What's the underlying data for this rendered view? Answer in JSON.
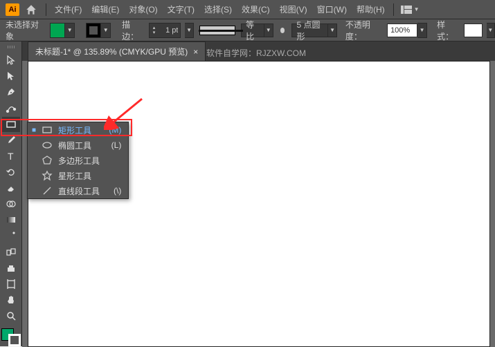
{
  "menubar": {
    "logo": "Ai",
    "items": [
      "文件(F)",
      "编辑(E)",
      "对象(O)",
      "文字(T)",
      "选择(S)",
      "效果(C)",
      "视图(V)",
      "窗口(W)",
      "帮助(H)"
    ]
  },
  "controlbar": {
    "no_selection": "未选择对象",
    "fill_color": "#00a651",
    "stroke_color": "#000000",
    "stroke_label": "描边：",
    "stroke_value": "1 pt",
    "scale_label": "等比",
    "brush_label": "5 点圆形",
    "opacity_label": "不透明度：",
    "opacity_value": "100%",
    "style_label": "样式："
  },
  "tab": {
    "title": "未标题-1* @ 135.89% (CMYK/GPU 预览)"
  },
  "watermark": "软件自学网：RJZXW.COM",
  "flyout": {
    "items": [
      {
        "label": "矩形工具",
        "shortcut": "(M)",
        "icon": "rect",
        "selected": true
      },
      {
        "label": "椭圆工具",
        "shortcut": "(L)",
        "icon": "ellipse",
        "selected": false
      },
      {
        "label": "多边形工具",
        "shortcut": "",
        "icon": "polygon",
        "selected": false
      },
      {
        "label": "星形工具",
        "shortcut": "",
        "icon": "star",
        "selected": false
      },
      {
        "label": "直线段工具",
        "shortcut": "(\\)",
        "icon": "line",
        "selected": false
      }
    ]
  },
  "colors": {
    "fill_swatch": "#00a86b",
    "stroke_swatch": "#ffffff"
  }
}
